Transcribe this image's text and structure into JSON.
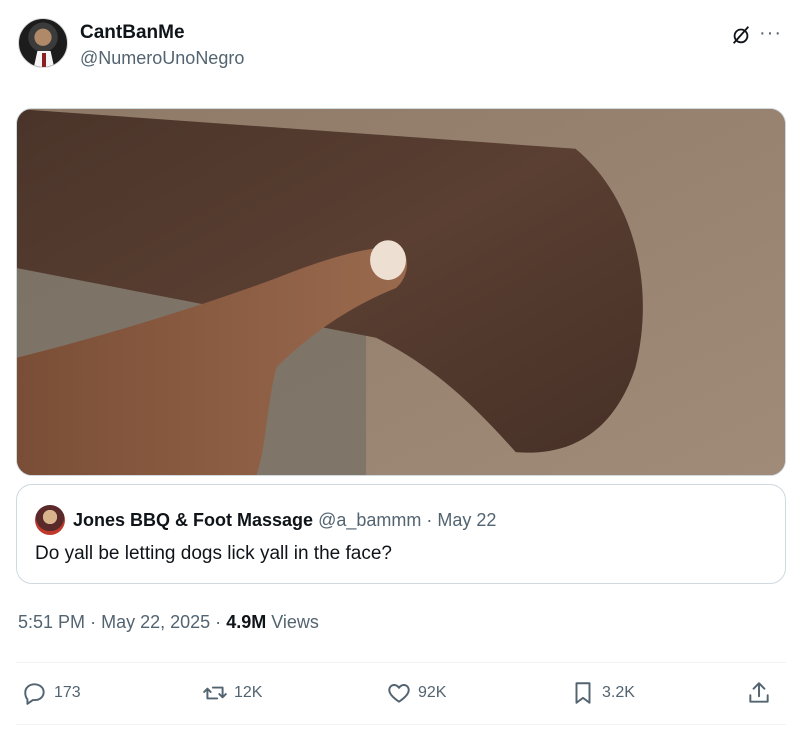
{
  "author": {
    "display_name": "CantBanMe",
    "handle": "@NumeroUnoNegro",
    "avatar_icon": "profile-photo-man-in-suit"
  },
  "header_actions": {
    "grok_icon": "grok-slash-circle-icon",
    "more_label": "···"
  },
  "media": {
    "description_icon": "photo-arm-and-pointing-finger"
  },
  "quoted_tweet": {
    "display_name": "Jones BBQ & Foot Massage",
    "handle": "@a_bammm",
    "separator": "·",
    "date": "May 22",
    "text": "Do yall be letting dogs lick yall in the face?"
  },
  "meta": {
    "time": "5:51 PM",
    "date": "May 22, 2025",
    "views_count": "4.9M",
    "views_label": "Views"
  },
  "actions": {
    "replies": "173",
    "retweets": "12K",
    "likes": "92K",
    "bookmarks": "3.2K"
  },
  "colors": {
    "text_primary": "#0f1419",
    "text_secondary": "#536471",
    "border": "#cfd9de"
  }
}
